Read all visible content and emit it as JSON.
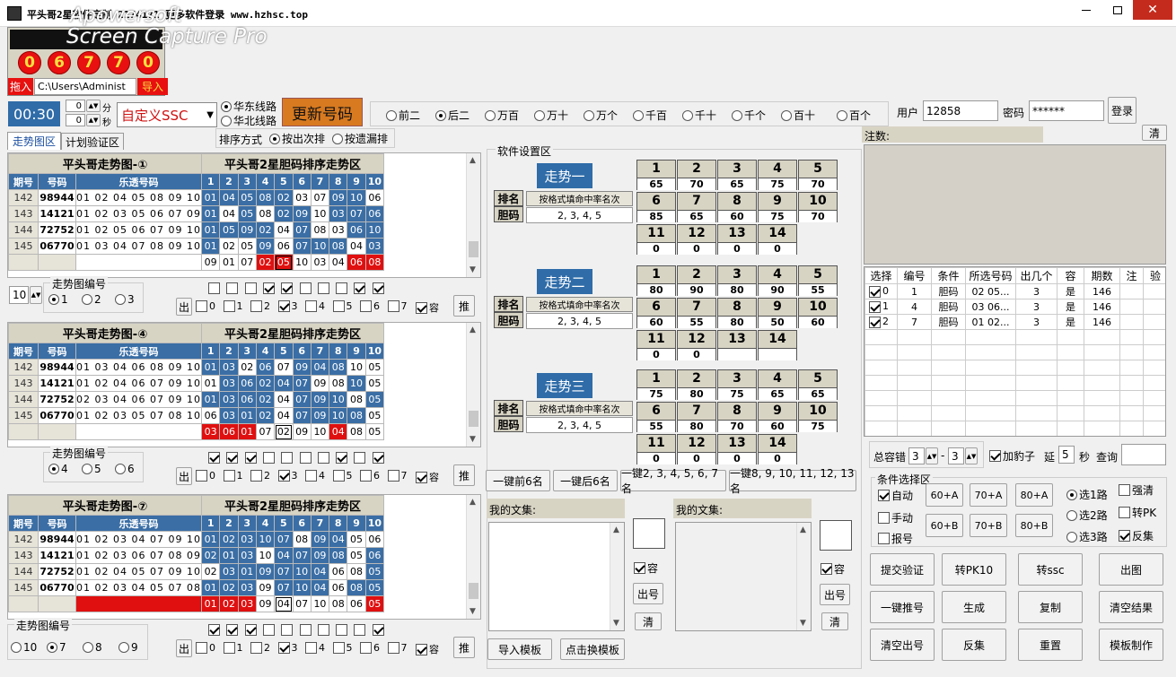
{
  "window": {
    "title": "平头哥2星软件定制 2174171 更多软件登录 www.hzhsc.top"
  },
  "watermark": {
    "line1": "Apowersoft",
    "line2": "Screen Capture Pro"
  },
  "balls": [
    "0",
    "6",
    "7",
    "7",
    "0"
  ],
  "top_left": {
    "import_in": "拖入",
    "path": "C:\\Users\\Administ",
    "import": "导入",
    "time": "00:30",
    "min_val": "0",
    "sec_val": "0",
    "min": "分",
    "sec": "秒"
  },
  "lottery_select": "自定义SSC",
  "lines": {
    "east": "华东线路",
    "north": "华北线路"
  },
  "update_button": "更新号码",
  "positions": [
    "前二",
    "后二",
    "万百",
    "万十",
    "万个",
    "千百",
    "千十",
    "千个",
    "百十",
    "百个"
  ],
  "position_selected": 1,
  "login": {
    "user_label": "用户",
    "user": "12858",
    "pwd_label": "密码",
    "pwd": "******",
    "button": "登录"
  },
  "tabs": [
    "走势图区",
    "计划验证区"
  ],
  "sort": {
    "label": "排序方式",
    "opt1": "按出次排",
    "opt2": "按遗漏排"
  },
  "charts": [
    {
      "title": "平头哥走势图-①",
      "title2": "平头哥2星胆码排序走势区",
      "rows": [
        {
          "p": "142",
          "n": "98944",
          "lt": "01 02 04 05 08 09 10",
          "cells": [
            [
              "01",
              "b"
            ],
            [
              "04",
              "b"
            ],
            [
              "05",
              "b"
            ],
            [
              "08",
              "b"
            ],
            [
              "02",
              "b"
            ],
            [
              "03",
              ""
            ],
            [
              "07",
              ""
            ],
            [
              "09",
              "b"
            ],
            [
              "10",
              "b"
            ],
            [
              "06",
              ""
            ]
          ]
        },
        {
          "p": "143",
          "n": "14121",
          "lt": "01 02 03 05 06 07 09",
          "cells": [
            [
              "01",
              "b"
            ],
            [
              "04",
              ""
            ],
            [
              "05",
              "b"
            ],
            [
              "08",
              ""
            ],
            [
              "02",
              "b"
            ],
            [
              "09",
              "b"
            ],
            [
              "10",
              ""
            ],
            [
              "03",
              "b"
            ],
            [
              "07",
              "b"
            ],
            [
              "06",
              "b"
            ]
          ]
        },
        {
          "p": "144",
          "n": "72752",
          "lt": "01 02 05 06 07 09 10",
          "cells": [
            [
              "01",
              "b"
            ],
            [
              "05",
              "b"
            ],
            [
              "09",
              "b"
            ],
            [
              "02",
              "b"
            ],
            [
              "04",
              ""
            ],
            [
              "07",
              "b"
            ],
            [
              "08",
              ""
            ],
            [
              "03",
              ""
            ],
            [
              "06",
              "b"
            ],
            [
              "10",
              "b"
            ]
          ]
        },
        {
          "p": "145",
          "n": "06770",
          "lt": "01 03 04 07 08 09 10",
          "cells": [
            [
              "01",
              "b"
            ],
            [
              "02",
              ""
            ],
            [
              "05",
              ""
            ],
            [
              "09",
              "b"
            ],
            [
              "06",
              ""
            ],
            [
              "07",
              "b"
            ],
            [
              "10",
              "b"
            ],
            [
              "08",
              "b"
            ],
            [
              "04",
              ""
            ],
            [
              "03",
              "b"
            ]
          ]
        }
      ],
      "last": [
        [
          "09",
          ""
        ],
        [
          "01",
          ""
        ],
        [
          "07",
          ""
        ],
        [
          "02",
          "r"
        ],
        [
          "05",
          "rb"
        ],
        [
          "10",
          ""
        ],
        [
          "03",
          ""
        ],
        [
          "04",
          ""
        ],
        [
          "06",
          "r"
        ],
        [
          "08",
          "r"
        ]
      ],
      "sel_label": "走势图编号",
      "spin": "10",
      "radios": [
        "1",
        "2",
        "3"
      ],
      "radio_on": 0,
      "top_checks": [
        false,
        false,
        false,
        true,
        true,
        false,
        false,
        false,
        true,
        true
      ]
    },
    {
      "title": "平头哥走势图-④",
      "title2": "平头哥2星胆码排序走势区",
      "rows": [
        {
          "p": "142",
          "n": "98944",
          "lt": "01 03 04 06 08 09 10",
          "cells": [
            [
              "01",
              "b"
            ],
            [
              "03",
              "b"
            ],
            [
              "02",
              ""
            ],
            [
              "06",
              "b"
            ],
            [
              "07",
              ""
            ],
            [
              "09",
              "b"
            ],
            [
              "04",
              "b"
            ],
            [
              "08",
              "b"
            ],
            [
              "10",
              ""
            ],
            [
              "05",
              ""
            ]
          ]
        },
        {
          "p": "143",
          "n": "14121",
          "lt": "01 02 04 06 07 09 10",
          "cells": [
            [
              "01",
              ""
            ],
            [
              "03",
              "b"
            ],
            [
              "06",
              "b"
            ],
            [
              "02",
              "b"
            ],
            [
              "04",
              "b"
            ],
            [
              "07",
              "b"
            ],
            [
              "09",
              ""
            ],
            [
              "08",
              ""
            ],
            [
              "10",
              "b"
            ],
            [
              "05",
              ""
            ]
          ]
        },
        {
          "p": "144",
          "n": "72752",
          "lt": "02 03 04 06 07 09 10",
          "cells": [
            [
              "01",
              "b"
            ],
            [
              "03",
              "b"
            ],
            [
              "06",
              "b"
            ],
            [
              "02",
              "b"
            ],
            [
              "04",
              ""
            ],
            [
              "07",
              "b"
            ],
            [
              "09",
              "b"
            ],
            [
              "10",
              "b"
            ],
            [
              "08",
              ""
            ],
            [
              "05",
              "b"
            ]
          ]
        },
        {
          "p": "145",
          "n": "06770",
          "lt": "01 02 03 05 07 08 10",
          "cells": [
            [
              "06",
              ""
            ],
            [
              "03",
              "b"
            ],
            [
              "01",
              "b"
            ],
            [
              "02",
              "b"
            ],
            [
              "04",
              ""
            ],
            [
              "07",
              "b"
            ],
            [
              "09",
              "b"
            ],
            [
              "10",
              "b"
            ],
            [
              "08",
              "b"
            ],
            [
              "05",
              ""
            ]
          ]
        }
      ],
      "last": [
        [
          "03",
          "r"
        ],
        [
          "06",
          "r"
        ],
        [
          "01",
          "r"
        ],
        [
          "07",
          ""
        ],
        [
          "02",
          "x"
        ],
        [
          "09",
          ""
        ],
        [
          "10",
          ""
        ],
        [
          "04",
          "r"
        ],
        [
          "08",
          ""
        ],
        [
          "05",
          ""
        ]
      ],
      "sel_label": "走势图编号",
      "spin": "",
      "radios": [
        "4",
        "5",
        "6"
      ],
      "radio_on": 0,
      "top_checks": [
        true,
        true,
        true,
        false,
        false,
        false,
        false,
        true,
        false,
        true
      ]
    },
    {
      "title": "平头哥走势图-⑦",
      "title2": "平头哥2星胆码排序走势区",
      "rows": [
        {
          "p": "142",
          "n": "98944",
          "lt": "01 02 03 04 07 09 10",
          "cells": [
            [
              "01",
              "b"
            ],
            [
              "02",
              "b"
            ],
            [
              "03",
              "b"
            ],
            [
              "10",
              "b"
            ],
            [
              "07",
              "b"
            ],
            [
              "08",
              ""
            ],
            [
              "09",
              "b"
            ],
            [
              "04",
              "b"
            ],
            [
              "05",
              ""
            ],
            [
              "06",
              ""
            ]
          ]
        },
        {
          "p": "143",
          "n": "14121",
          "lt": "01 02 03 06 07 08 09",
          "cells": [
            [
              "02",
              "b"
            ],
            [
              "01",
              "b"
            ],
            [
              "03",
              "b"
            ],
            [
              "10",
              ""
            ],
            [
              "04",
              "b"
            ],
            [
              "07",
              "b"
            ],
            [
              "09",
              "b"
            ],
            [
              "08",
              "b"
            ],
            [
              "05",
              ""
            ],
            [
              "06",
              "b"
            ]
          ]
        },
        {
          "p": "144",
          "n": "72752",
          "lt": "01 02 04 05 07 09 10",
          "cells": [
            [
              "02",
              ""
            ],
            [
              "03",
              "b"
            ],
            [
              "01",
              "b"
            ],
            [
              "09",
              "b"
            ],
            [
              "07",
              "b"
            ],
            [
              "10",
              "b"
            ],
            [
              "04",
              "b"
            ],
            [
              "06",
              ""
            ],
            [
              "08",
              ""
            ],
            [
              "05",
              "b"
            ]
          ]
        },
        {
          "p": "145",
          "n": "06770",
          "lt": "01 02 03 04 05 07 08",
          "cells": [
            [
              "01",
              "b"
            ],
            [
              "02",
              "b"
            ],
            [
              "03",
              "b"
            ],
            [
              "09",
              ""
            ],
            [
              "07",
              "b"
            ],
            [
              "10",
              "b"
            ],
            [
              "04",
              "b"
            ],
            [
              "06",
              ""
            ],
            [
              "08",
              "b"
            ],
            [
              "05",
              "b"
            ]
          ]
        }
      ],
      "last": [
        [
          "01",
          "r"
        ],
        [
          "02",
          "r"
        ],
        [
          "03",
          "r"
        ],
        [
          "09",
          ""
        ],
        [
          "04",
          "x"
        ],
        [
          "07",
          ""
        ],
        [
          "10",
          ""
        ],
        [
          "08",
          ""
        ],
        [
          "06",
          ""
        ],
        [
          "05",
          "r"
        ]
      ],
      "sel_label": "走势图编号",
      "spin": "",
      "radios": [
        "10",
        "7",
        "8",
        "9"
      ],
      "radio_on": 1,
      "top_checks": [
        true,
        true,
        true,
        false,
        false,
        false,
        false,
        false,
        false,
        true
      ]
    }
  ],
  "table_head": {
    "period": "期号",
    "number": "号码",
    "lotto": "乐透号码",
    "cols": [
      "1",
      "2",
      "3",
      "4",
      "5",
      "6",
      "7",
      "8",
      "9",
      "10"
    ]
  },
  "out_row": {
    "label": "出",
    "items": [
      "0",
      "1",
      "2",
      "3",
      "4",
      "5",
      "6",
      "7",
      "容"
    ],
    "push": "推"
  },
  "settings": {
    "title": "软件设置区",
    "rank": "排名",
    "dan": "胆码",
    "fmt": "按格式填命中率名次",
    "value": "2, 3, 4, 5"
  },
  "trends": [
    {
      "name": "走势一",
      "nums": [
        "65",
        "70",
        "65",
        "75",
        "70",
        "85",
        "65",
        "60",
        "75",
        "70",
        "0",
        "0",
        "0",
        "0"
      ]
    },
    {
      "name": "走势二",
      "nums": [
        "80",
        "90",
        "80",
        "90",
        "55",
        "60",
        "55",
        "80",
        "50",
        "60",
        "0",
        "0",
        "",
        ""
      ]
    },
    {
      "name": "走势三",
      "nums": [
        "75",
        "80",
        "75",
        "65",
        "65",
        "55",
        "80",
        "70",
        "60",
        "75",
        "0",
        "0",
        "0",
        "0"
      ]
    }
  ],
  "grid_labels": [
    "1",
    "2",
    "3",
    "4",
    "5",
    "6",
    "7",
    "8",
    "9",
    "10",
    "11",
    "12",
    "13",
    "14"
  ],
  "quick_buttons": [
    "一键前6名",
    "一键后6名",
    "一键2, 3, 4, 5, 6, 7名",
    "一键8, 9, 10, 11, 12, 13名"
  ],
  "collection": {
    "title": "我的文集:",
    "rong": "容",
    "out": "出号",
    "clear": "清",
    "import": "导入模板",
    "switch": "点击换模板"
  },
  "notes": {
    "label": "注数:",
    "clear": "清"
  },
  "grid": {
    "head": [
      "选择",
      "编号",
      "条件",
      "所选号码",
      "出几个",
      "容",
      "期数",
      "注 ",
      "验"
    ],
    "rows": [
      {
        "sel": true,
        "idx": "0",
        "no": "1",
        "cond": "胆码",
        "nums": "02 05...",
        "cnt": "3",
        "rong": "是",
        "per": "146"
      },
      {
        "sel": true,
        "idx": "1",
        "no": "4",
        "cond": "胆码",
        "nums": "03 06...",
        "cnt": "3",
        "rong": "是",
        "per": "146"
      },
      {
        "sel": true,
        "idx": "2",
        "no": "7",
        "cond": "胆码",
        "nums": "01 02...",
        "cnt": "3",
        "rong": "是",
        "per": "146"
      }
    ]
  },
  "tolerance": {
    "label": "总容错",
    "a": "3",
    "dash": "-",
    "b": "3",
    "jia": "加豹子",
    "yan": "延",
    "yan_val": "5",
    "miao": "秒",
    "query": "查询"
  },
  "cond": {
    "title": "条件选择区",
    "auto": "自动",
    "manual": "手动",
    "report": "报号",
    "btns": [
      "60+A",
      "70+A",
      "80+A",
      "60+B",
      "70+B",
      "80+B"
    ],
    "r1": "选1路",
    "r2": "选2路",
    "r3": "选3路",
    "strong": "强清",
    "pk": "转PK",
    "rev": "反集"
  },
  "actions": [
    "提交验证",
    "转PK10",
    "转ssc",
    "出图",
    "一键推号",
    "生成",
    "复制",
    "清空结果",
    "清空出号",
    "反集",
    "重置",
    "模板制作"
  ]
}
